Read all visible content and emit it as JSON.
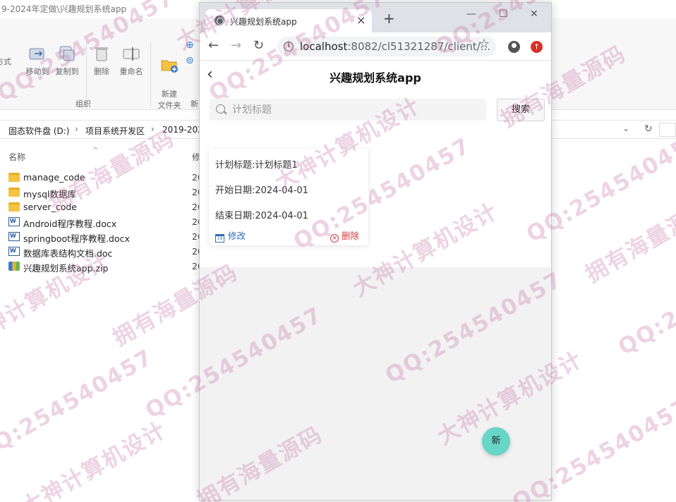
{
  "explorer": {
    "title": "9-2024年定做\\兴趣规划系统app",
    "ribbon": {
      "layout_partial": "方式",
      "move_to": "移动到",
      "copy_to": "复制到",
      "delete": "删除",
      "rename": "重命名",
      "new_folder": "新建\n文件夹",
      "group_organize": "组织",
      "group_new_partial": "新"
    },
    "breadcrumb": [
      "固态软件盘 (D:)",
      "项目系统开发区",
      "2019-202"
    ],
    "columns": {
      "name": "名称",
      "modified_partial": "修"
    },
    "files": [
      {
        "name": "manage_code",
        "type": "folder",
        "date": "20"
      },
      {
        "name": "mysql数据库",
        "type": "folder",
        "date": "20"
      },
      {
        "name": "server_code",
        "type": "folder",
        "date": "20"
      },
      {
        "name": "Android程序教程.docx",
        "type": "doc",
        "date": "20"
      },
      {
        "name": "springboot程序教程.docx",
        "type": "doc",
        "date": "20"
      },
      {
        "name": "数据库表结构文档.doc",
        "type": "doc",
        "date": "20"
      },
      {
        "name": "兴趣规划系统app.zip",
        "type": "zip",
        "date": "20"
      }
    ]
  },
  "browser": {
    "tab_title": "兴趣规划系统app",
    "url_host": "localhost",
    "url_rest": ":8082/cl51321287/client/...",
    "icons": [
      "globe-icon",
      "close-icon",
      "plus-icon",
      "back-arrow-icon",
      "forward-arrow-icon",
      "reload-icon",
      "info-icon",
      "star-icon",
      "account-icon",
      "update-icon"
    ]
  },
  "app": {
    "title": "兴趣规划系统app",
    "search": {
      "placeholder": "计划标题",
      "button": "搜索"
    },
    "cards": [
      {
        "title_line": "计划标题:计划标题1",
        "start_line": "开始日期:2024-04-01",
        "end_line": "结束日期:2024-04-01",
        "edit": "修改",
        "delete": "删除"
      }
    ],
    "fab": "新"
  },
  "watermark": {
    "texts": [
      "QQ:254540457",
      "大神计算机设计",
      "拥有海量源码"
    ],
    "color": "#c878aa"
  }
}
